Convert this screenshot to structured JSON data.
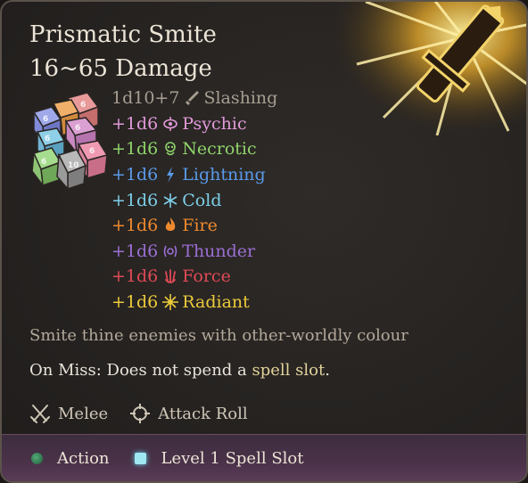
{
  "spell": {
    "name": "Prismatic Smite",
    "damage_total": "16~65 Damage",
    "art_icon": "spell-art-icon",
    "dice_icon": "dice-stack-icon"
  },
  "damage": [
    {
      "dice": "1d10+7",
      "type": "Slashing",
      "icon": "sword-icon",
      "color": "#a79e92"
    },
    {
      "dice": "+1d6",
      "type": "Psychic",
      "icon": "psychic-eye-icon",
      "color": "#e39ad9"
    },
    {
      "dice": "+1d6",
      "type": "Necrotic",
      "icon": "necrotic-skull-icon",
      "color": "#8fd46a"
    },
    {
      "dice": "+1d6",
      "type": "Lightning",
      "icon": "lightning-icon",
      "color": "#5a9ae8"
    },
    {
      "dice": "+1d6",
      "type": "Cold",
      "icon": "snowflake-icon",
      "color": "#7dcfe8"
    },
    {
      "dice": "+1d6",
      "type": "Fire",
      "icon": "flame-icon",
      "color": "#f08a2e"
    },
    {
      "dice": "+1d6",
      "type": "Thunder",
      "icon": "thunder-icon",
      "color": "#9b6fd4"
    },
    {
      "dice": "+1d6",
      "type": "Force",
      "icon": "force-hand-icon",
      "color": "#e04a55"
    },
    {
      "dice": "+1d6",
      "type": "Radiant",
      "icon": "radiant-icon",
      "color": "#eccb3b"
    }
  ],
  "description": "Smite thine enemies with other-worldly colour",
  "on_miss": {
    "prefix": "On Miss: Does not spend a ",
    "highlight": "spell slot",
    "suffix": "."
  },
  "properties": [
    {
      "label": "Melee",
      "icon": "crossed-swords-icon"
    },
    {
      "label": "Attack Roll",
      "icon": "crosshair-icon"
    }
  ],
  "cost": [
    {
      "label": "Action",
      "icon": "action-dot-icon",
      "color": "#2f8a56"
    },
    {
      "label": "Level 1 Spell Slot",
      "icon": "spell-slot-icon",
      "color": "#9fe8f2"
    }
  ]
}
